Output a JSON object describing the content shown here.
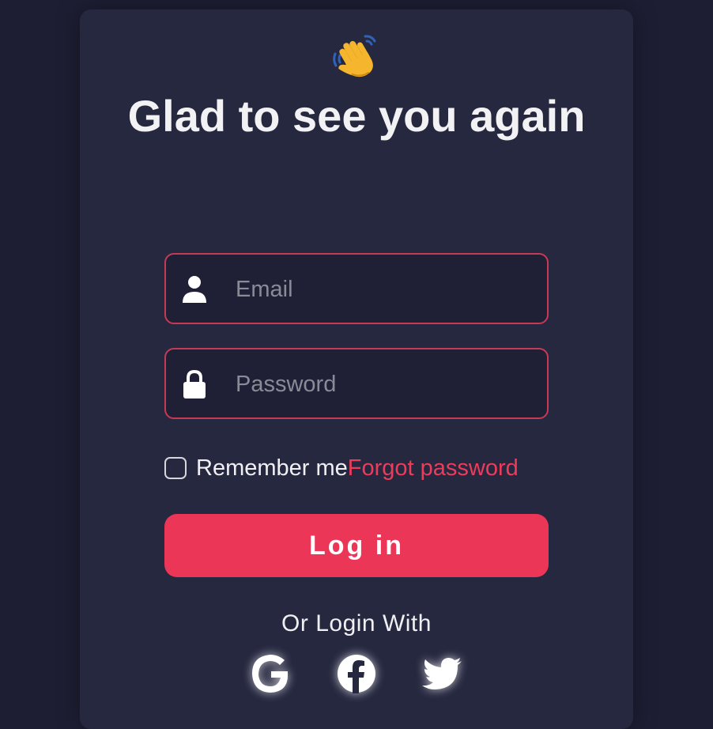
{
  "login": {
    "title": "Glad to see you again",
    "email_placeholder": "Email",
    "password_placeholder": "Password",
    "remember_label": "Remember me",
    "forgot_label": "Forgot password",
    "login_button_label": "Log in",
    "alt_login_label": "Or Login With"
  },
  "icons": {
    "greeting": "waving-hand-icon",
    "email": "user-icon",
    "password": "lock-icon",
    "socials": [
      "google-icon",
      "facebook-icon",
      "twitter-icon"
    ]
  },
  "colors": {
    "background": "#1d1e33",
    "card": "#262840",
    "accent": "#ec3657",
    "field_border": "#c73a56",
    "text": "#f0f0f2",
    "placeholder": "#8b8b97"
  }
}
